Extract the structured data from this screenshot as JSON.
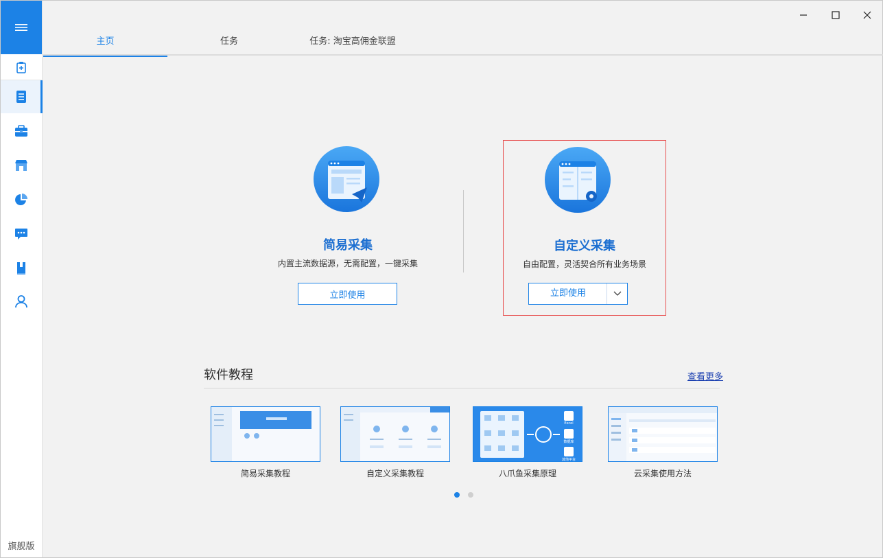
{
  "sidebar": {
    "edition": "旗舰版",
    "icons": [
      "menu-icon",
      "new-task-icon",
      "task-list-icon",
      "toolbox-icon",
      "store-icon",
      "chart-pie-icon",
      "message-icon",
      "book-icon",
      "user-icon"
    ]
  },
  "tabs": [
    {
      "label": "主页"
    },
    {
      "label": "任务"
    },
    {
      "label": "任务: 淘宝高佣金联盟"
    }
  ],
  "cards": [
    {
      "title": "简易采集",
      "desc": "内置主流数据源，无需配置，一键采集",
      "button": "立即使用"
    },
    {
      "title": "自定义采集",
      "desc": "自由配置，灵活契合所有业务场景",
      "button": "立即使用"
    }
  ],
  "tutorials": {
    "title": "软件教程",
    "see_more": "查看更多",
    "items": [
      {
        "label": "简易采集教程"
      },
      {
        "label": "自定义采集教程"
      },
      {
        "label": "八爪鱼采集原理"
      },
      {
        "label": "云采集使用方法"
      }
    ],
    "thumb_texts": {
      "excel": "Excel",
      "db": "数据库",
      "platform": "其他平台"
    }
  },
  "colors": {
    "accent": "#1c82e6",
    "highlight_border": "#e74c4c",
    "title_blue": "#1c6fd1"
  }
}
